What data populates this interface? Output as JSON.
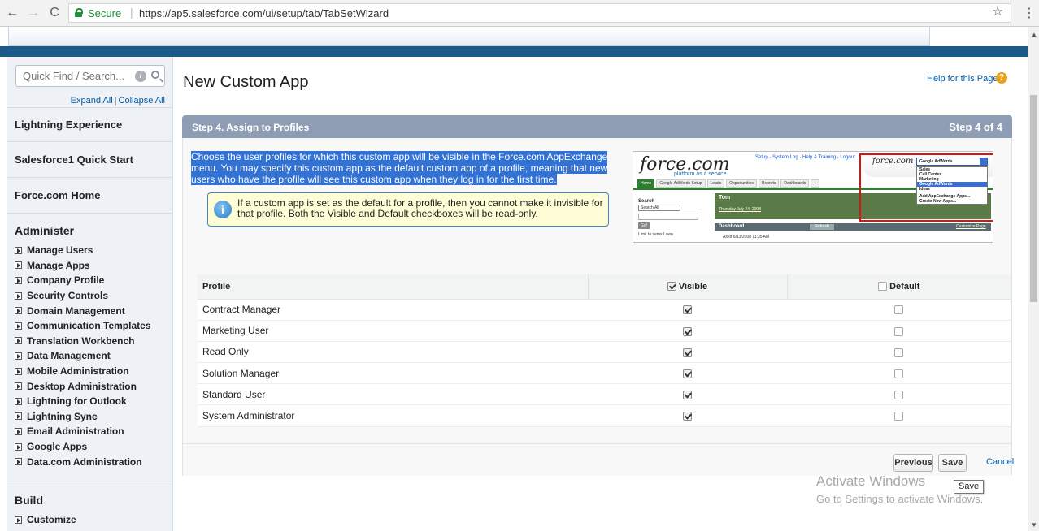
{
  "browser": {
    "secure_label": "Secure",
    "url": "https://ap5.salesforce.com/ui/setup/tab/TabSetWizard"
  },
  "sidebar": {
    "search_placeholder": "Quick Find / Search...",
    "expand_all": "Expand All",
    "separator": "|",
    "collapse_all": "Collapse All",
    "sections": [
      "Lightning Experience",
      "Salesforce1 Quick Start",
      "Force.com Home",
      "Administer"
    ],
    "administer_links": [
      "Manage Users",
      "Manage Apps",
      "Company Profile",
      "Security Controls",
      "Domain Management",
      "Communication Templates",
      "Translation Workbench",
      "Data Management",
      "Mobile Administration",
      "Desktop Administration",
      "Lightning for Outlook",
      "Lightning Sync",
      "Email Administration",
      "Google Apps",
      "Data.com Administration"
    ],
    "build_section": "Build",
    "build_links": [
      "Customize"
    ]
  },
  "main": {
    "title": "New Custom App",
    "help_link": "Help for this Page",
    "step_title": "Step 4. Assign to Profiles",
    "step_count": "Step 4 of 4",
    "instructions": "Choose the user profiles for which this custom app will be visible in the Force.com AppExchange menu. You may specify this custom app as the default custom app of a profile, meaning that new users who have the profile will see this custom app when they log in for the first time.",
    "note": "If a custom app is set as the default for a profile, then you cannot make it invisible for that profile. Both the Visible and Default checkboxes will be read-only."
  },
  "illustration": {
    "logo": "force.com",
    "tagline": "platform as a service",
    "header_links": "Setup · System Log · Help & Training · Logout",
    "tabs": [
      "Home",
      "Google AdWords Setup",
      "Leads",
      "Opportunities",
      "Reports",
      "Dashboards",
      "+"
    ],
    "search_label": "Search",
    "search_scope": "Search All",
    "go_label": "Go!",
    "limit_label": "Limit to items I own",
    "user_name": "Tom",
    "date_text": "Thursday July 24, 2008",
    "dashboard_label": "Dashboard",
    "refresh_label": "Refresh",
    "customize_label": "Customize Page",
    "as_of_text": "As of 6/13/2008 11:35 AM",
    "logo_small": "force.com",
    "dropdown_value": "Google AdWords",
    "menu_items": [
      "Sales",
      "Call Center",
      "Marketing",
      "Google AdWords",
      "Ideas"
    ],
    "menu_extra": [
      "Add AppExchange Apps...",
      "Create New Apps..."
    ]
  },
  "table": {
    "columns": {
      "profile": "Profile",
      "visible": "Visible",
      "default": "Default"
    },
    "visible_header_checked": true,
    "default_header_checked": false,
    "rows": [
      {
        "profile": "Contract Manager",
        "visible": true,
        "default": false
      },
      {
        "profile": "Marketing User",
        "visible": true,
        "default": false
      },
      {
        "profile": "Read Only",
        "visible": true,
        "default": false
      },
      {
        "profile": "Solution Manager",
        "visible": true,
        "default": false
      },
      {
        "profile": "Standard User",
        "visible": true,
        "default": false
      },
      {
        "profile": "System Administrator",
        "visible": true,
        "default": false
      }
    ]
  },
  "buttons": {
    "previous": "Previous",
    "save": "Save",
    "cancel": "Cancel"
  },
  "tooltip": "Save",
  "watermark": {
    "title": "Activate Windows",
    "subtitle": "Go to Settings to activate Windows."
  }
}
